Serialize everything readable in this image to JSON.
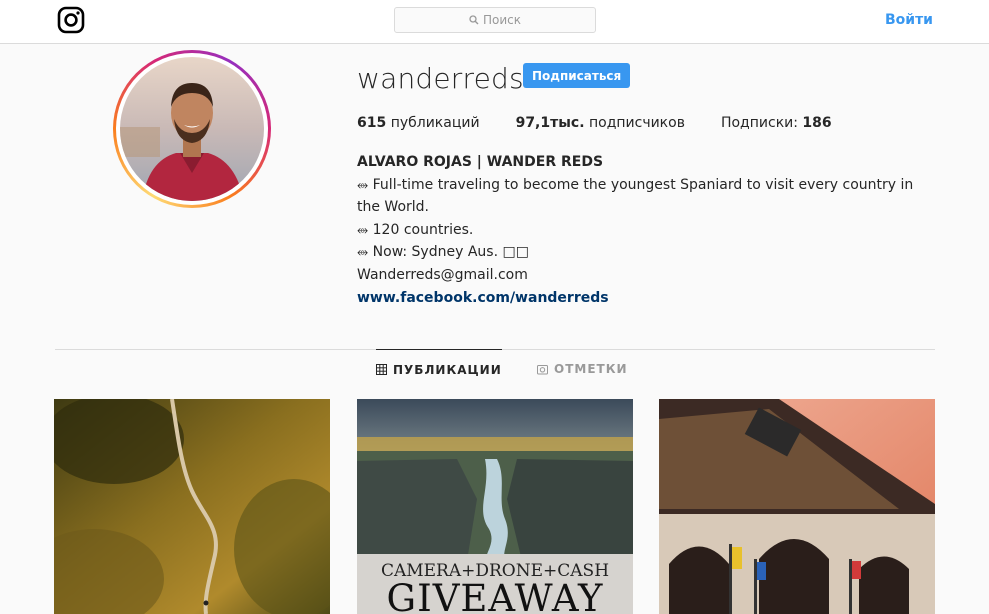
{
  "nav": {
    "search_placeholder": "Поиск",
    "login_label": "Войти"
  },
  "profile": {
    "username": "wanderreds",
    "follow_label": "Подписаться",
    "stats": {
      "posts_count": "615",
      "posts_label": "публикаций",
      "followers_count": "97,1тыс.",
      "followers_label": "подписчиков",
      "following_label": "Подписки:",
      "following_count": "186"
    },
    "bio": {
      "full_name": "ALVARO ROJAS | WANDER REDS",
      "line1": "⥈ Full-time traveling to become the youngest Spaniard to visit every country in the World.",
      "line2": "⥈ 120 countries.",
      "line3": "⥈ Now: Sydney Aus. □□",
      "email": "Wanderreds@gmail.com",
      "website": "www.facebook.com/wanderreds"
    }
  },
  "tabs": [
    {
      "label": "ПУБЛИКАЦИИ",
      "icon": "grid-icon",
      "active": true
    },
    {
      "label": "ОТМЕТКИ",
      "icon": "tag-photo-icon",
      "active": false
    }
  ],
  "posts": [
    {
      "subject": "mountain-trail-aerial"
    },
    {
      "subject": "canyon-river",
      "overlay_small": "CAMERA+DRONE+CASH",
      "overlay_big": "GIVEAWAY"
    },
    {
      "subject": "korean-palace-gate"
    }
  ],
  "colors": {
    "accent": "#3897f0",
    "link": "#003569",
    "muted": "#999999",
    "border": "#dbdbdb"
  }
}
